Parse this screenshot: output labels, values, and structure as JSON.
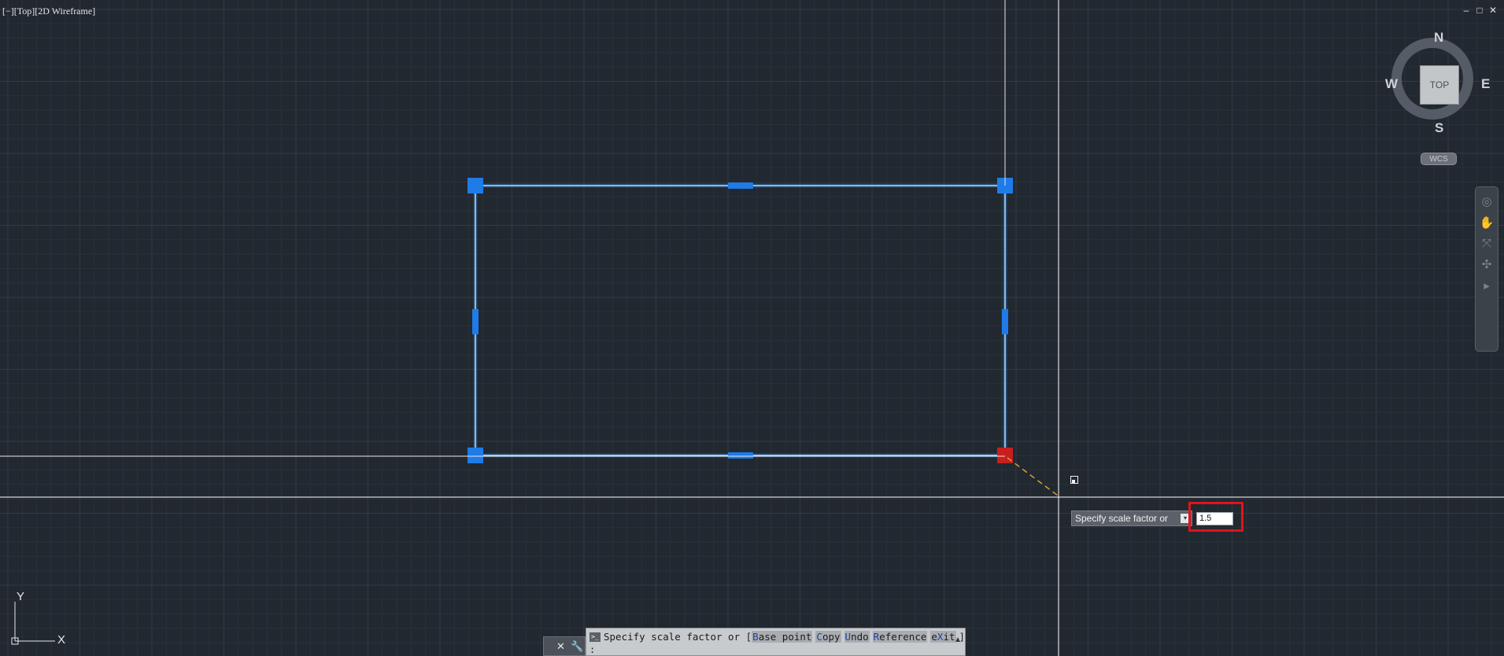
{
  "viewport": {
    "label": "[−][Top][2D Wireframe]",
    "window_controls": [
      "–",
      "□",
      "✕"
    ]
  },
  "viewcube": {
    "face_label": "TOP",
    "north": "N",
    "south": "S",
    "east": "E",
    "west": "W",
    "ucs_label": "WCS"
  },
  "ucs_icon": {
    "x_label": "X",
    "y_label": "Y"
  },
  "dynamic_input": {
    "prompt": "Specify scale factor or",
    "value": "1.5"
  },
  "command_line": {
    "prefix": "Specify scale factor or [",
    "options": [
      {
        "key": "B",
        "rest": "ase point"
      },
      {
        "key": "C",
        "rest": "opy"
      },
      {
        "key": "U",
        "rest": "ndo"
      },
      {
        "key": "R",
        "rest": "eference"
      },
      {
        "key": "",
        "rest": "e",
        "key2": "X",
        "rest2": "it"
      }
    ],
    "suffix": "]",
    "second_line": ":"
  },
  "colors": {
    "background": "#212830",
    "grid_minor": "#2a313a",
    "grid_major": "#323a44",
    "selection": "#2d8cf0",
    "grip": "#1e7be8",
    "hot_grip": "#c81e1e",
    "crosshair": "#ffffff",
    "rubberband": "#d9a03a",
    "highlight": "#e0141a"
  }
}
